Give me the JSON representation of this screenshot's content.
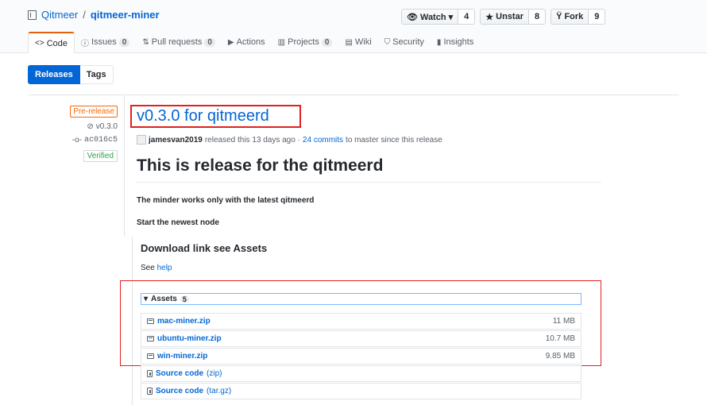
{
  "repo": {
    "owner": "Qitmeer",
    "separator": "/",
    "name": "qitmeer-miner"
  },
  "actions": [
    {
      "label": "Watch ▾",
      "count": "4",
      "icon": "eye-icon"
    },
    {
      "label": "Unstar",
      "count": "8",
      "icon": "star-icon"
    },
    {
      "label": "Fork",
      "count": "9",
      "icon": "fork-icon"
    }
  ],
  "tabs": [
    {
      "label": "Code",
      "icon": "code-icon",
      "count": null
    },
    {
      "label": "Issues",
      "icon": "issue-icon",
      "count": "0"
    },
    {
      "label": "Pull requests",
      "icon": "pull-request-icon",
      "count": "0"
    },
    {
      "label": "Actions",
      "icon": "play-icon",
      "count": null
    },
    {
      "label": "Projects",
      "icon": "project-icon",
      "count": "0"
    },
    {
      "label": "Wiki",
      "icon": "book-icon",
      "count": null
    },
    {
      "label": "Security",
      "icon": "shield-icon",
      "count": null
    },
    {
      "label": "Insights",
      "icon": "graph-icon",
      "count": null
    }
  ],
  "subnav": {
    "releases": "Releases",
    "tags": "Tags"
  },
  "release": {
    "badge": "Pre-release",
    "tag": "v0.3.0",
    "commit": "ac016c5",
    "verified": "Verified",
    "title": "v0.3.0 for qitmeerd",
    "author": "jamesvan2019",
    "released_text": "released this 13 days ago ·",
    "commits_link": "24 commits",
    "commits_suffix": "to master since this release",
    "heading": "This is release for the qitmeerd",
    "line1": "The minder works only with the latest qitmeerd",
    "line2": "Start the newest node",
    "download_heading": "Download link see Assets",
    "see": "See",
    "help": "help"
  },
  "assets": {
    "label": "Assets",
    "count": "5",
    "files": [
      {
        "name": "mac-miner.zip",
        "size": "11 MB"
      },
      {
        "name": "ubuntu-miner.zip",
        "size": "10.7 MB"
      },
      {
        "name": "win-miner.zip",
        "size": "9.85 MB"
      }
    ],
    "source": [
      {
        "name": "Source code",
        "ext": "(zip)"
      },
      {
        "name": "Source code",
        "ext": "(tar.gz)"
      }
    ]
  },
  "colors": {
    "link": "#0366d6",
    "prerelease": "#f66a0a",
    "verified": "#28a745",
    "highlight": "#e0211f"
  }
}
